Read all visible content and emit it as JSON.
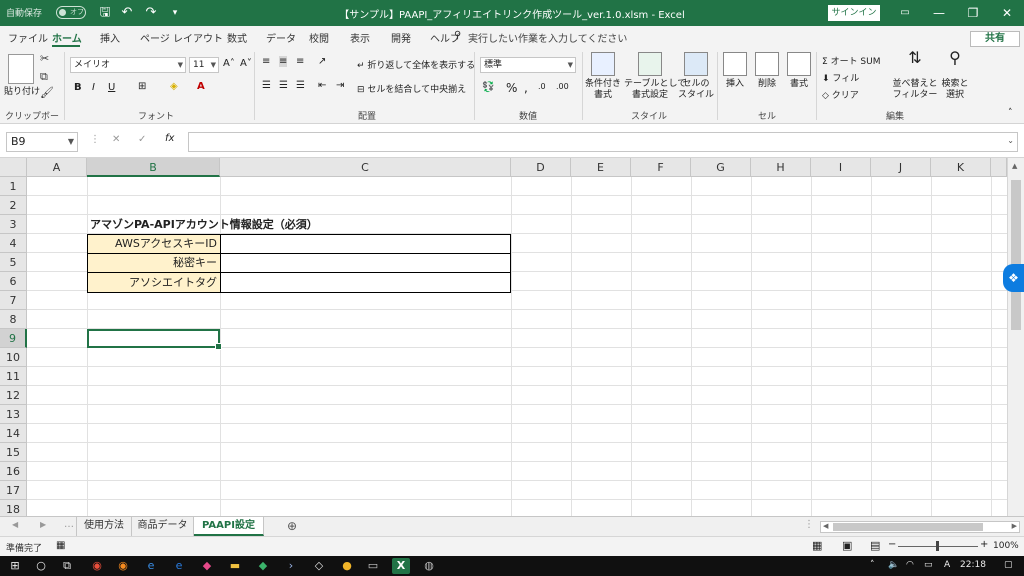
{
  "titlebar": {
    "autosave_label": "自動保存",
    "autosave_state": "オフ",
    "title": "【サンプル】PAAPI_アフィリエイトリンク作成ツール_ver.1.0.xlsm  -  Excel",
    "signin": "サインイン"
  },
  "ribbon_tabs": [
    "ファイル",
    "ホーム",
    "挿入",
    "ページ レイアウト",
    "数式",
    "データ",
    "校閲",
    "表示",
    "開発",
    "ヘルプ"
  ],
  "tell_me": "実行したい作業を入力してください",
  "share": "共有",
  "ribbon": {
    "clipboard": {
      "paste": "貼り付け",
      "label": "クリップボード"
    },
    "font": {
      "name": "メイリオ",
      "size": "11",
      "label": "フォント"
    },
    "alignment": {
      "wrap": "折り返して全体を表示する",
      "merge": "セルを結合して中央揃え",
      "label": "配置"
    },
    "number": {
      "format": "標準",
      "label": "数値"
    },
    "styles": {
      "conditional": "条件付き\n書式",
      "as_table": "テーブルとして\n書式設定",
      "cell_styles": "セルの\nスタイル",
      "label": "スタイル"
    },
    "cells": {
      "insert": "挿入",
      "delete": "削除",
      "format": "書式",
      "label": "セル"
    },
    "editing": {
      "autosum": "オート SUM",
      "fill": "フィル",
      "clear": "クリア",
      "sort": "並べ替えと\nフィルター",
      "find": "検索と\n選択",
      "label": "編集"
    }
  },
  "formula_bar": {
    "name_box": "B9",
    "fx": "fx",
    "content": ""
  },
  "columns": [
    "A",
    "B",
    "C",
    "D",
    "E",
    "F",
    "G",
    "H",
    "I",
    "J",
    "K"
  ],
  "rows": [
    "1",
    "2",
    "3",
    "4",
    "5",
    "6",
    "7",
    "8",
    "9",
    "10",
    "11",
    "12",
    "13",
    "14",
    "15",
    "16",
    "17",
    "18"
  ],
  "sheet": {
    "heading": "アマゾンPA-APIアカウント情報設定（必須）",
    "fields": [
      {
        "label": "AWSアクセスキーID",
        "value": ""
      },
      {
        "label": "秘密キー",
        "value": ""
      },
      {
        "label": "アソシエイトタグ",
        "value": ""
      }
    ]
  },
  "sheet_tabs": [
    "使用方法",
    "商品データ",
    "PAAPI設定"
  ],
  "status": {
    "ready": "準備完了",
    "zoom": "100%"
  },
  "taskbar": {
    "time": "22:18",
    "ime": "A"
  },
  "colors": {
    "excel_green": "#217346",
    "label_fill": "#fff2cc"
  }
}
